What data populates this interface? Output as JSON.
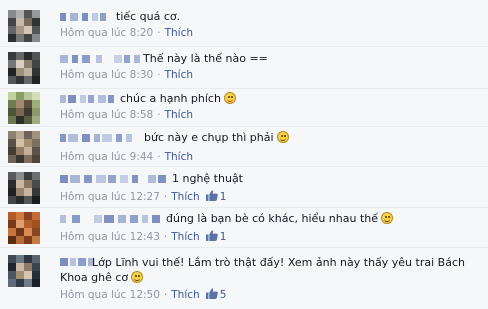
{
  "comments": [
    {
      "text": "tiếc quá cơ.",
      "emoji": "",
      "time": "Hôm qua lúc 8:20",
      "action": "Thích",
      "likes": ""
    },
    {
      "text": "Thế này là thế nào ==",
      "emoji": "",
      "time": "Hôm qua lúc 8:30",
      "action": "Thích",
      "likes": ""
    },
    {
      "text": "chúc a hạnh phích",
      "emoji": "tongue-emoji",
      "time": "Hôm qua lúc 8:58",
      "action": "Thích",
      "likes": ""
    },
    {
      "text": "bức này e chụp thì phải",
      "emoji": "smile-emoji",
      "time": "Hôm qua lúc 9:44",
      "action": "Thích",
      "likes": ""
    },
    {
      "text": "1 nghệ thuật",
      "emoji": "",
      "time": "Hôm qua lúc 12:27",
      "action": "Thích",
      "likes": "1"
    },
    {
      "text": "đúng là bạn bè có khác, hiểu nhau thế",
      "emoji": "smile-emoji",
      "time": "Hôm qua lúc 12:43",
      "action": "Thích",
      "likes": "1"
    },
    {
      "text": "Lớp Lĩnh vui thế! Lắm trò thật đấy! Xem ảnh này thấy yêu trai Bách Khoa ghê cơ",
      "emoji": "smile-emoji",
      "time": "Hôm qua lúc 12:50",
      "action": "Thích",
      "likes": "5"
    }
  ],
  "colors": {
    "background": "#f6f7f9",
    "meta_text": "#9197a3",
    "link": "#3b5998",
    "text": "#141823"
  },
  "icons": {
    "like": "thumbs-up-icon",
    "avatar": "pixelated-avatar"
  }
}
